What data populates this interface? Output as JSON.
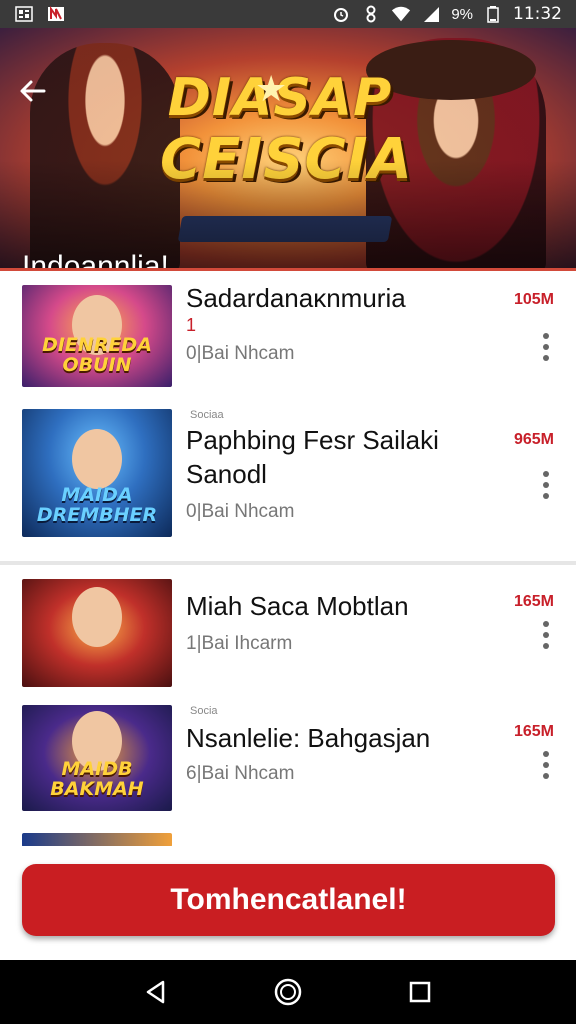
{
  "status_bar": {
    "left_icons": [
      "qr-code-icon",
      "app-notification-icon"
    ],
    "battery_text": "9%",
    "time": "11:32"
  },
  "hero": {
    "logo_line1": "DIASAP",
    "logo_line2": "CEISCIA",
    "subtitle": "Indoannlia!"
  },
  "items": [
    {
      "title": "Sadardanaĸnmuria",
      "mark": "1",
      "meta": "0|Bai Nhcam",
      "size": "105M",
      "thumb_title": "DIENREDA OBUIN",
      "thumb_colors": [
        "#3a1f6a",
        "#d54a8a",
        "#ffb04a"
      ]
    },
    {
      "small": "Sociaa",
      "title": "Paphbing Fesr Sailaki Sanodl",
      "meta": "0|Bai Nhcam",
      "size": "965M",
      "thumb_title": "MAIDA DREMBHER",
      "thumb_colors": [
        "#0d2a5a",
        "#2f6fc0",
        "#6ac0ff"
      ]
    },
    {
      "title": "Miah Saca Mobtlan",
      "meta": "1|Bai Ihcarm",
      "size": "165M",
      "thumb_colors": [
        "#4a1010",
        "#c0302a",
        "#ffb04a"
      ]
    },
    {
      "small": "Socia",
      "title": "Nsanlelie: Bahgasjan",
      "meta": "6|Bai Nhcam",
      "size": "165M",
      "thumb_title": "MAIDB BAKMAH",
      "thumb_colors": [
        "#1a1a4a",
        "#4a2a8a",
        "#f0a03a"
      ]
    }
  ],
  "cta": {
    "label": "Tomhencatlanel!"
  },
  "nav": [
    "back-icon",
    "home-icon",
    "recents-icon"
  ]
}
